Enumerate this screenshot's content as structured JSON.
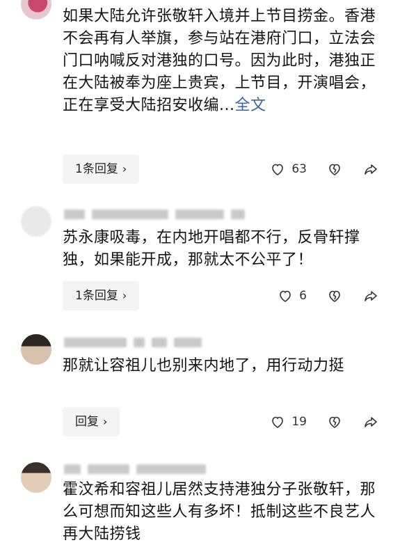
{
  "comments": [
    {
      "text": "如果大陆允许张敬轩入境并上节目捞金。香港不会再有人举旗，参与站在港府门口，立法会门口呐喊反对港独的口号。因为此时，港独正在大陆被奉为座上贵宾，上节目，开演唱会，正在享受大陆招安收编",
      "ellipsis": "...",
      "more": "全文",
      "reply": "1条回复",
      "likes": "63"
    },
    {
      "text": "苏永康吸毒，在内地开唱都不行，反骨轩撑独，如果能开成，那就太不公平了！",
      "reply": "1条回复",
      "likes": "6"
    },
    {
      "text": "那就让容祖儿也别来内地了，用行动力挺",
      "reply": "回复",
      "likes": "19"
    },
    {
      "text": "霍汶希和容祖儿居然支持港独分子张敬轩，那么可想而知这些人有多坏！抵制这些不良艺人再大陆捞钱"
    }
  ],
  "icons": {
    "like": "heart-outline-icon",
    "dislike": "broken-heart-icon",
    "share": "share-arrow-icon",
    "chevron": "chevron-right-icon"
  },
  "colors": {
    "link": "#3d63a6",
    "button_bg": "#f4f4f4",
    "text": "#141414"
  }
}
